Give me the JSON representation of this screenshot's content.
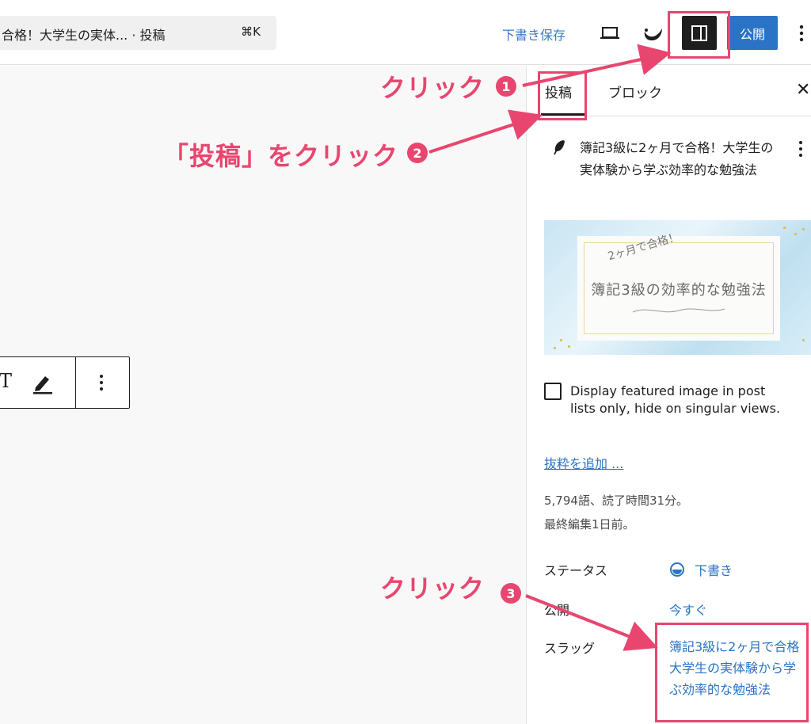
{
  "topbar": {
    "command_title": "合格！大学生の実体... · 投稿",
    "command_shortcut": "⌘K",
    "save_draft": "下書き保存",
    "publish": "公開",
    "icons": [
      "desktop-preview-icon",
      "view-icon",
      "settings-sidebar-icon",
      "more-options-icon"
    ]
  },
  "block_toolbar": {
    "text_icon_label": "T",
    "icons": [
      "text-style-icon",
      "highlight-pen-icon",
      "more-vertical-icon"
    ]
  },
  "sidebar": {
    "tabs": [
      {
        "label": "投稿",
        "active": true
      },
      {
        "label": "ブロック",
        "active": false
      }
    ],
    "close_icon": "close-icon",
    "post_title": "簿記3級に2ヶ月で合格！大学生の実体験から学ぶ効率的な勉強法",
    "featured_image": {
      "subtitle": "2ヶ月で合格！",
      "main_text": "簿記3級の効率的な勉強法"
    },
    "checkbox_label": "Display featured image in post lists only, hide on singular views.",
    "checkbox_checked": false,
    "excerpt_link": "抜粋を追加 ...",
    "word_count": "5,794語、読了時間31分。",
    "last_edited": "最終編集1日前。",
    "rows": {
      "status_label": "ステータス",
      "status_value": "下書き",
      "publish_label": "公開",
      "publish_value": "今すぐ",
      "slug_label": "スラッグ",
      "slug_value": "簿記3級に2ヶ月で合格大学生の実体験から学ぶ効率的な勉強法"
    }
  },
  "annotations": {
    "step1": "クリック",
    "step1_num": "1",
    "step2": "「投稿」をクリック",
    "step2_num": "2",
    "step3": "クリック",
    "step3_num": "3"
  },
  "colors": {
    "accent": "#2b73c5",
    "annotation": "#e8466f",
    "dark": "#1e1e1e"
  }
}
